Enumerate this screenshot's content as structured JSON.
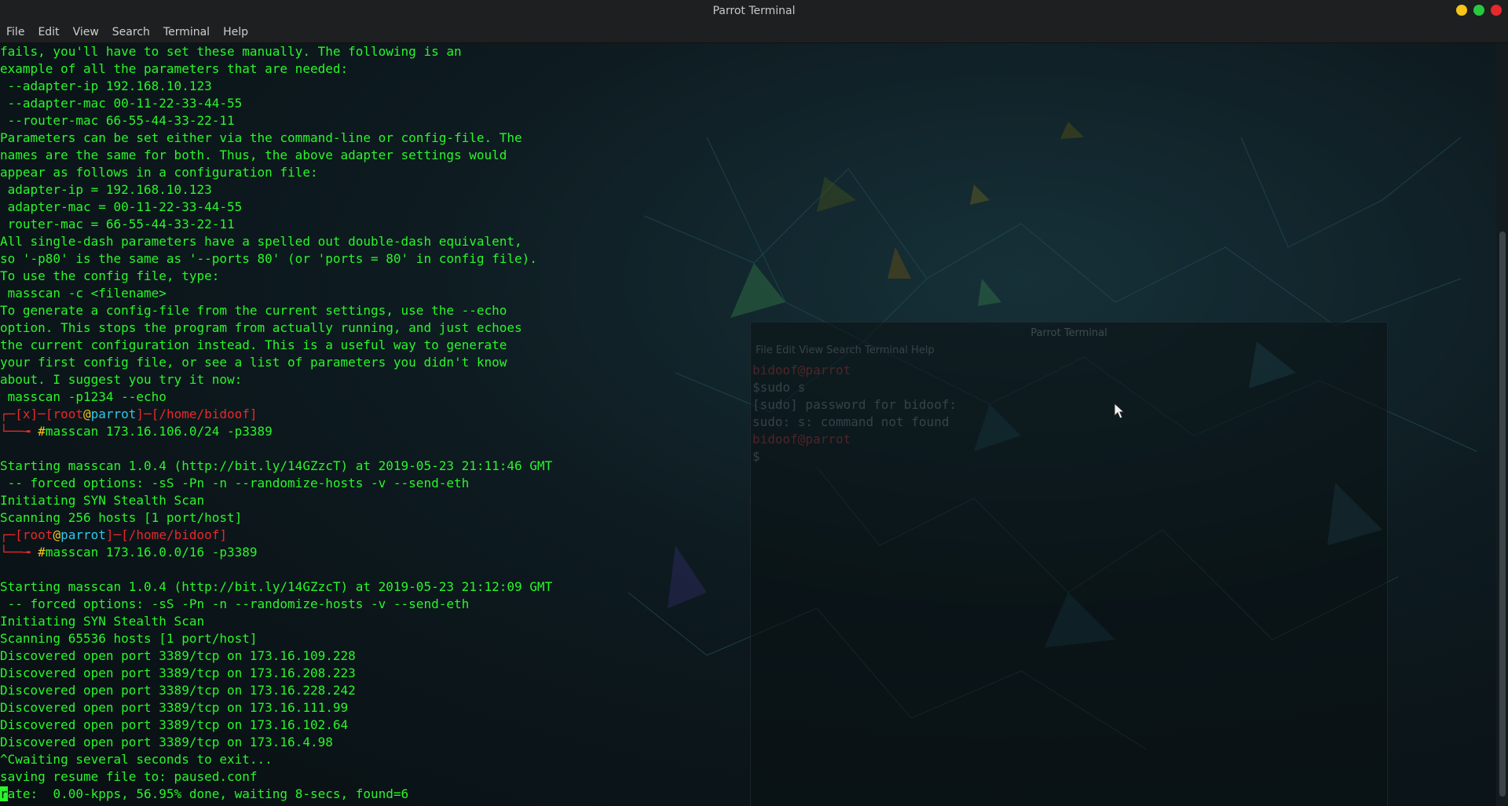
{
  "window": {
    "title": "Parrot Terminal"
  },
  "menu": [
    "File",
    "Edit",
    "View",
    "Search",
    "Terminal",
    "Help"
  ],
  "colors": {
    "text": "#2af52a",
    "prompt_bracket": "#e8282b",
    "host": "#30c8e8",
    "at": "#f2c61e",
    "close": "#e8282b",
    "maximize": "#27c93f",
    "minimize": "#f5c518"
  },
  "terminal": {
    "lines": [
      "fails, you'll have to set these manually. The following is an",
      "example of all the parameters that are needed:",
      " --adapter-ip 192.168.10.123",
      " --adapter-mac 00-11-22-33-44-55",
      " --router-mac 66-55-44-33-22-11",
      "Parameters can be set either via the command-line or config-file. The",
      "names are the same for both. Thus, the above adapter settings would",
      "appear as follows in a configuration file:",
      " adapter-ip = 192.168.10.123",
      " adapter-mac = 00-11-22-33-44-55",
      " router-mac = 66-55-44-33-22-11",
      "All single-dash parameters have a spelled out double-dash equivalent,",
      "so '-p80' is the same as '--ports 80' (or 'ports = 80' in config file).",
      "To use the config file, type:",
      " masscan -c <filename>",
      "To generate a config-file from the current settings, use the --echo",
      "option. This stops the program from actually running, and just echoes",
      "the current configuration instead. This is a useful way to generate",
      "your first config file, or see a list of parameters you didn't know",
      "about. I suggest you try it now:",
      " masscan -p1234 --echo"
    ],
    "prompt1": {
      "status": "x",
      "user": "root",
      "at": "@",
      "host": "parrot",
      "path": "/home/bidoof",
      "command": "masscan 173.16.106.0/24 -p3389"
    },
    "output1": [
      "",
      "Starting masscan 1.0.4 (http://bit.ly/14GZzcT) at 2019-05-23 21:11:46 GMT",
      " -- forced options: -sS -Pn -n --randomize-hosts -v --send-eth",
      "Initiating SYN Stealth Scan",
      "Scanning 256 hosts [1 port/host]"
    ],
    "prompt2": {
      "user": "root",
      "at": "@",
      "host": "parrot",
      "path": "/home/bidoof",
      "command": "masscan 173.16.0.0/16 -p3389"
    },
    "output2": [
      "",
      "Starting masscan 1.0.4 (http://bit.ly/14GZzcT) at 2019-05-23 21:12:09 GMT",
      " -- forced options: -sS -Pn -n --randomize-hosts -v --send-eth",
      "Initiating SYN Stealth Scan",
      "Scanning 65536 hosts [1 port/host]",
      "Discovered open port 3389/tcp on 173.16.109.228",
      "Discovered open port 3389/tcp on 173.16.208.223",
      "Discovered open port 3389/tcp on 173.16.228.242",
      "Discovered open port 3389/tcp on 173.16.111.99",
      "Discovered open port 3389/tcp on 173.16.102.64",
      "Discovered open port 3389/tcp on 173.16.4.98",
      "^Cwaiting several seconds to exit...",
      "saving resume file to: paused.conf"
    ],
    "status_first_char": "r",
    "status_rest": "ate:  0.00-kpps, 56.95% done, waiting 8-secs, found=6"
  },
  "background_window": {
    "title": "Parrot Terminal",
    "menu": "File  Edit  View  Search  Terminal  Help",
    "lines": [
      "bidoof@parrot",
      "$sudo s",
      "[sudo] password for bidoof:",
      "sudo: s: command not found",
      "bidoof@parrot",
      "$"
    ]
  }
}
